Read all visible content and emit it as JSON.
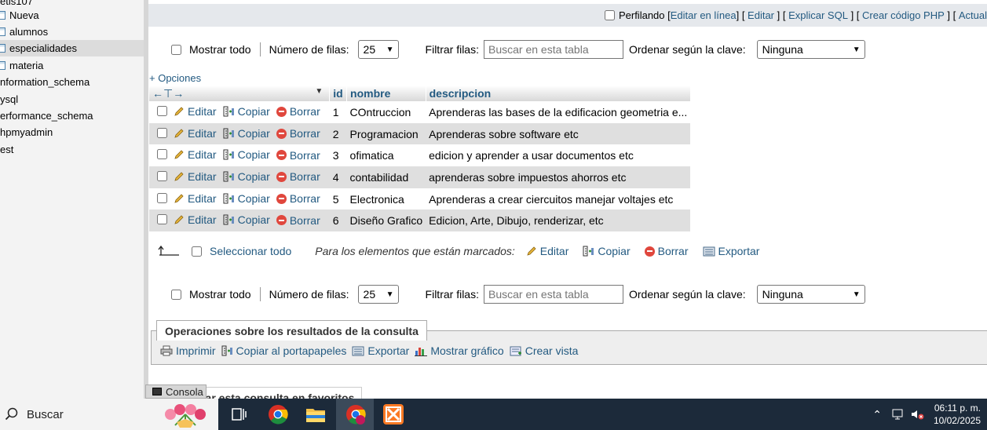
{
  "sidebar": {
    "items": [
      {
        "label": "etis107",
        "type": "db"
      },
      {
        "label": "Nueva",
        "type": "table"
      },
      {
        "label": "alumnos",
        "type": "table"
      },
      {
        "label": "especialidades",
        "type": "table",
        "active": true
      },
      {
        "label": "materia",
        "type": "table"
      },
      {
        "label": "nformation_schema",
        "type": "db"
      },
      {
        "label": "ysql",
        "type": "db"
      },
      {
        "label": "erformance_schema",
        "type": "db"
      },
      {
        "label": "hpmyadmin",
        "type": "db"
      },
      {
        "label": "est",
        "type": "db"
      }
    ]
  },
  "topbar": {
    "profiling_label": "Perfilando",
    "edit_inline": "Editar en línea",
    "edit": "Editar",
    "explain": "Explicar SQL",
    "create_php": "Crear código PHP",
    "refresh": "Actual"
  },
  "nav": {
    "show_all": "Mostrar todo",
    "rows_label": "Número de filas:",
    "rows_value": "25",
    "filter_label": "Filtrar filas:",
    "filter_placeholder": "Buscar en esta tabla",
    "sort_label": "Ordenar según la clave:",
    "sort_value": "Ninguna"
  },
  "options_link": "+ Opciones",
  "table": {
    "columns": [
      "id",
      "nombre",
      "descripcion"
    ],
    "actions": {
      "edit": "Editar",
      "copy": "Copiar",
      "delete": "Borrar"
    },
    "rows": [
      {
        "id": "1",
        "nombre": "COntruccion",
        "descripcion": "Aprenderas las bases de la edificacion geometria e..."
      },
      {
        "id": "2",
        "nombre": "Programacion",
        "descripcion": "Aprenderas sobre software etc"
      },
      {
        "id": "3",
        "nombre": "ofimatica",
        "descripcion": "edicion y aprender a usar documentos etc"
      },
      {
        "id": "4",
        "nombre": "contabilidad",
        "descripcion": "aprenderas sobre impuestos ahorros etc"
      },
      {
        "id": "5",
        "nombre": "Electronica",
        "descripcion": "Aprenderas a crear ciercuitos manejar voltajes etc"
      },
      {
        "id": "6",
        "nombre": "Diseño Grafico",
        "descripcion": "Edicion, Arte, Dibujo, renderizar, etc"
      }
    ]
  },
  "bulk": {
    "select_all": "Seleccionar todo",
    "marked_label": "Para los elementos que están marcados:",
    "edit": "Editar",
    "copy": "Copiar",
    "delete": "Borrar",
    "export": "Exportar"
  },
  "operations": {
    "title": "Operaciones sobre los resultados de la consulta",
    "print": "Imprimir",
    "copy_clipboard": "Copiar al portapapeles",
    "export": "Exportar",
    "chart": "Mostrar gráfico",
    "create_view": "Crear vista"
  },
  "bookmark_partial": "dar esta consulta en favoritos",
  "console_label": "Consola",
  "taskbar": {
    "search_label": "Buscar",
    "time": "06:11 p. m.",
    "date": "10/02/2025"
  }
}
